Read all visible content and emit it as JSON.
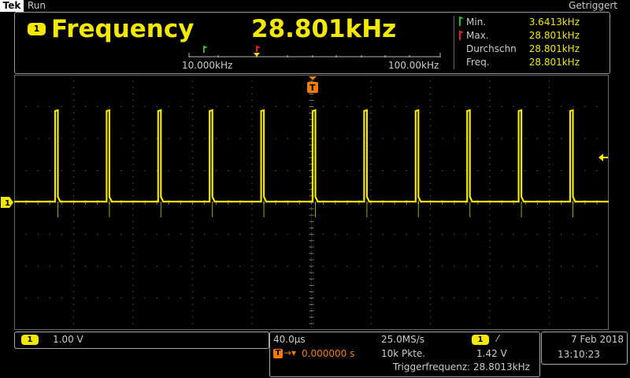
{
  "header": {
    "brand": "Tek",
    "run_state": "Run",
    "trigger_state": "Getriggert"
  },
  "measurement": {
    "channel": "1",
    "name": "Frequency",
    "value": "28.801kHz",
    "range_left": "10.000kHz",
    "range_right": "100.00kHz",
    "stats": [
      {
        "label": "Min.",
        "value": "3.6413kHz"
      },
      {
        "label": "Max.",
        "value": "28.801kHz"
      },
      {
        "label": "Durchschn",
        "value": "28.801kHz"
      },
      {
        "label": "Freq.",
        "value": "28.801kHz"
      }
    ]
  },
  "waveform": {
    "channel_marker": "1",
    "trigger_marker": "T",
    "color": "#f2e800"
  },
  "footer": {
    "channel": {
      "badge": "1",
      "scale": "1.00 V"
    },
    "timebase": {
      "time_div": "40.0µs",
      "sample_rate": "25.0MS/s",
      "trig_badge": "1",
      "trig_slope": "⁄",
      "trig_icon": "T",
      "position": "0.000000 s",
      "points": "10k Pkte.",
      "trig_level": "1.42 V",
      "trig_freq": "Triggerfrequenz: 28.8013kHz"
    },
    "datetime": {
      "date": "7 Feb  2018",
      "time": "13:10:23"
    }
  },
  "colors": {
    "channel1": "#f2e800",
    "trigger": "#f27c00",
    "border": "#9a9a9a"
  }
}
